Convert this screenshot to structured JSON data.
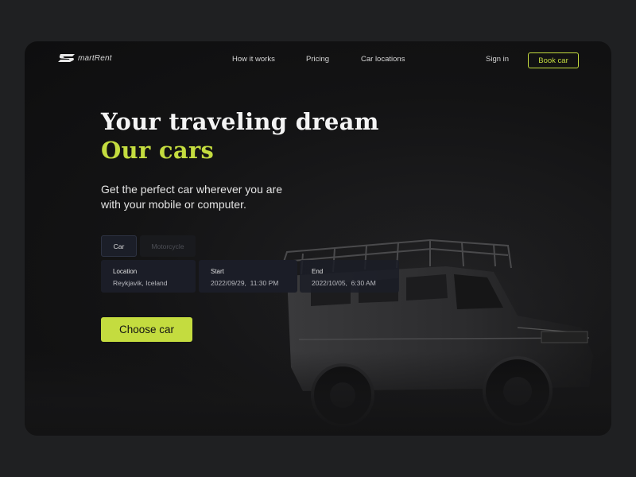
{
  "brand": {
    "logo_text": "martRent",
    "accent_color": "#c4dc3f"
  },
  "nav": {
    "links": [
      "How it works",
      "Pricing",
      "Car locations"
    ],
    "sign_in": "Sign in",
    "book_button": "Book car"
  },
  "hero": {
    "title_line1": "Your traveling dream",
    "title_line2": "Our cars",
    "subtitle": "Get the perfect car wherever you are with your mobile or computer."
  },
  "search": {
    "tabs": [
      {
        "label": "Car",
        "selected": true
      },
      {
        "label": "Motorcycle",
        "selected": false
      }
    ],
    "fields": [
      {
        "label": "Location",
        "value": "Reykjavik, Iceland"
      },
      {
        "label": "Start",
        "value": "2022/09/29,  11:30 PM"
      },
      {
        "label": "End",
        "value": "2022/10/05,  6:30 AM"
      }
    ],
    "submit_label": "Choose car"
  },
  "icons": {
    "logo": "smartrent-logo-icon"
  }
}
